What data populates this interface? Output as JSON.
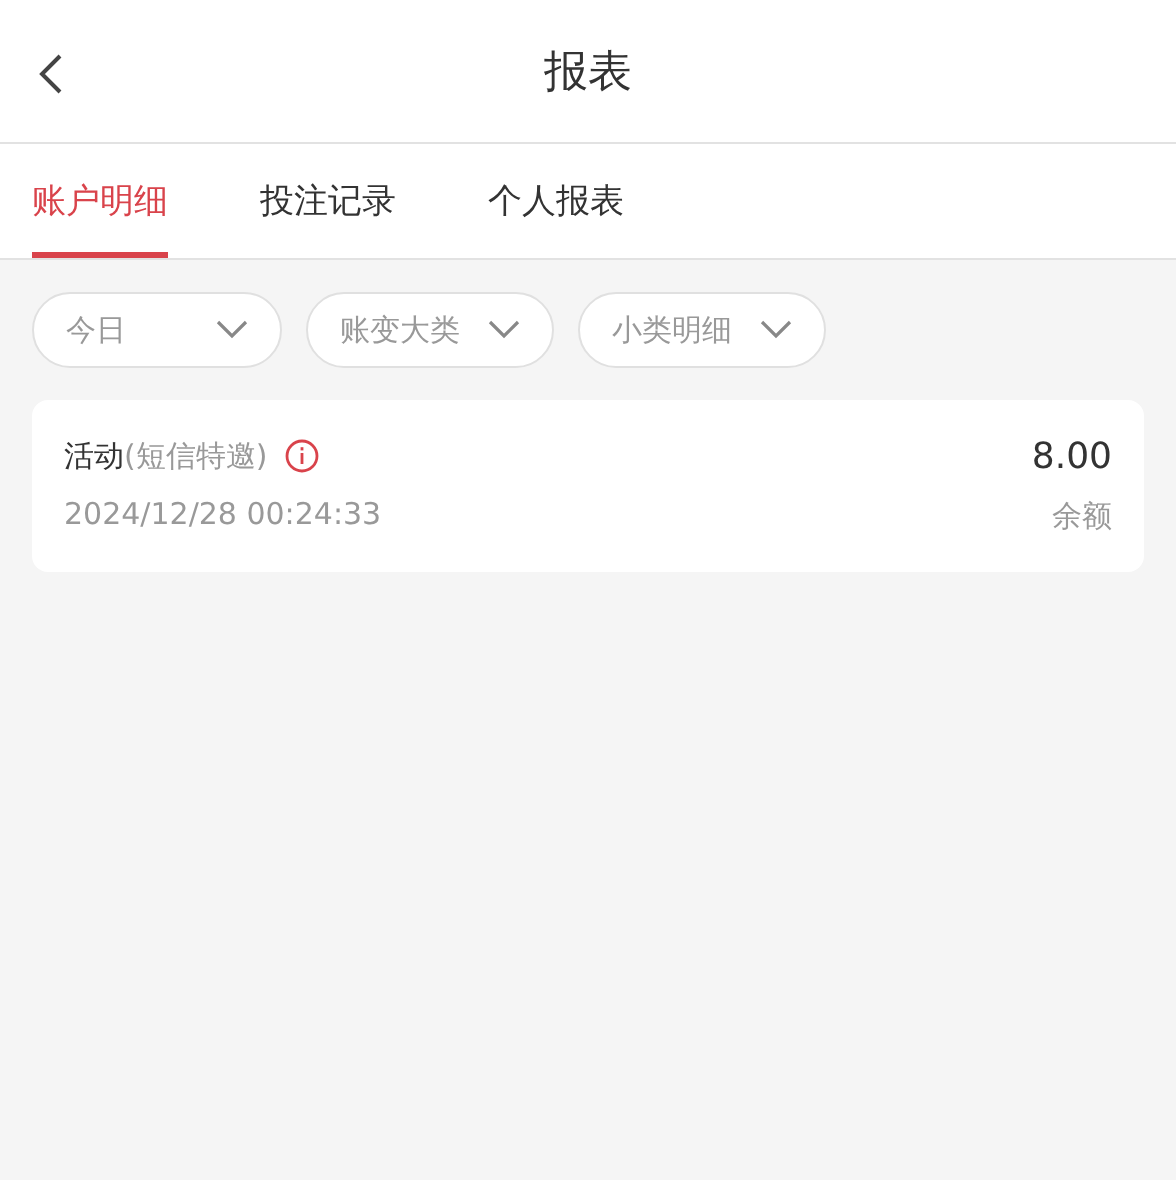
{
  "header": {
    "title": "报表"
  },
  "tabs": [
    {
      "label": "账户明细",
      "selected": true
    },
    {
      "label": "投注记录",
      "selected": false
    },
    {
      "label": "个人报表",
      "selected": false
    }
  ],
  "filters": [
    {
      "label": "今日"
    },
    {
      "label": "账变大类"
    },
    {
      "label": "小类明细"
    }
  ],
  "records": [
    {
      "category": "活动",
      "subcategory": "(短信特邀)",
      "time": "2024/12/28 00:24:33",
      "amount": "8.00",
      "amount_label": "余额"
    }
  ]
}
